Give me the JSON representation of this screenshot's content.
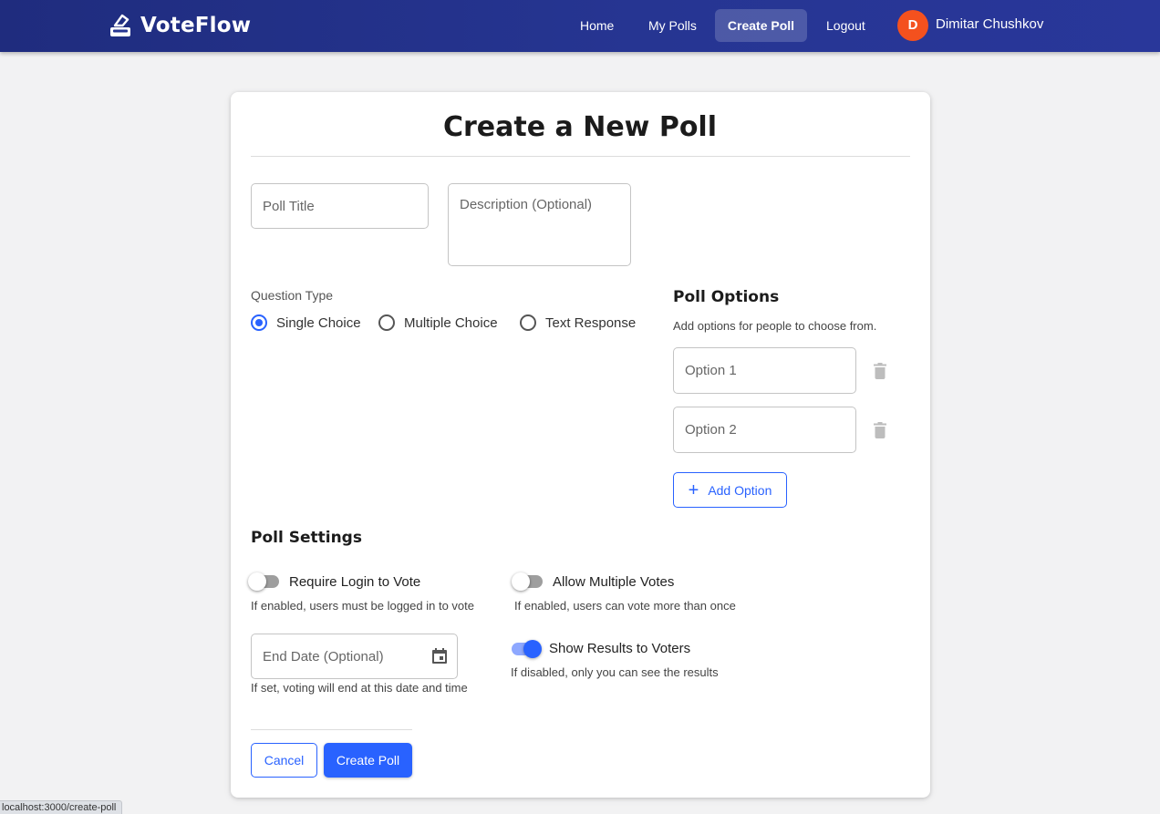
{
  "app": {
    "name": "VoteFlow",
    "logo_icon": "ballot-box-icon"
  },
  "nav": {
    "items": [
      {
        "label": "Home"
      },
      {
        "label": "My Polls"
      },
      {
        "label": "Create Poll",
        "active": true
      },
      {
        "label": "Logout"
      }
    ],
    "user": {
      "initial": "D",
      "name": "Dimitar Chushkov",
      "avatar_color": "#f4511e"
    }
  },
  "page": {
    "title": "Create a New Poll"
  },
  "form": {
    "title_placeholder": "Poll Title",
    "description_placeholder": "Description (Optional)",
    "question_type": {
      "label": "Question Type",
      "options": [
        "Single Choice",
        "Multiple Choice",
        "Text Response"
      ],
      "selected": "Single Choice"
    },
    "poll_options": {
      "title": "Poll Options",
      "subtitle": "Add options for people to choose from.",
      "options": [
        {
          "placeholder": "Option 1"
        },
        {
          "placeholder": "Option 2"
        }
      ],
      "add_label": "Add Option",
      "delete_icon": "trash-icon"
    },
    "settings": {
      "title": "Poll Settings",
      "require_login": {
        "label": "Require Login to Vote",
        "help": "If enabled, users must be logged in to vote",
        "enabled": false
      },
      "allow_multiple": {
        "label": "Allow Multiple Votes",
        "help": "If enabled, users can vote more than once",
        "enabled": false
      },
      "show_results": {
        "label": "Show Results to Voters",
        "help": "If disabled, only you can see the results",
        "enabled": true
      },
      "end_date": {
        "placeholder": "End Date (Optional)",
        "help": "If set, voting will end at this date and time",
        "icon": "calendar-icon"
      }
    },
    "actions": {
      "cancel_label": "Cancel",
      "submit_label": "Create Poll"
    }
  },
  "status_bar": {
    "url": "localhost:3000/create-poll"
  },
  "colors": {
    "primary": "#2962ff",
    "navbar": "#263592",
    "background": "#f2f2f3"
  }
}
